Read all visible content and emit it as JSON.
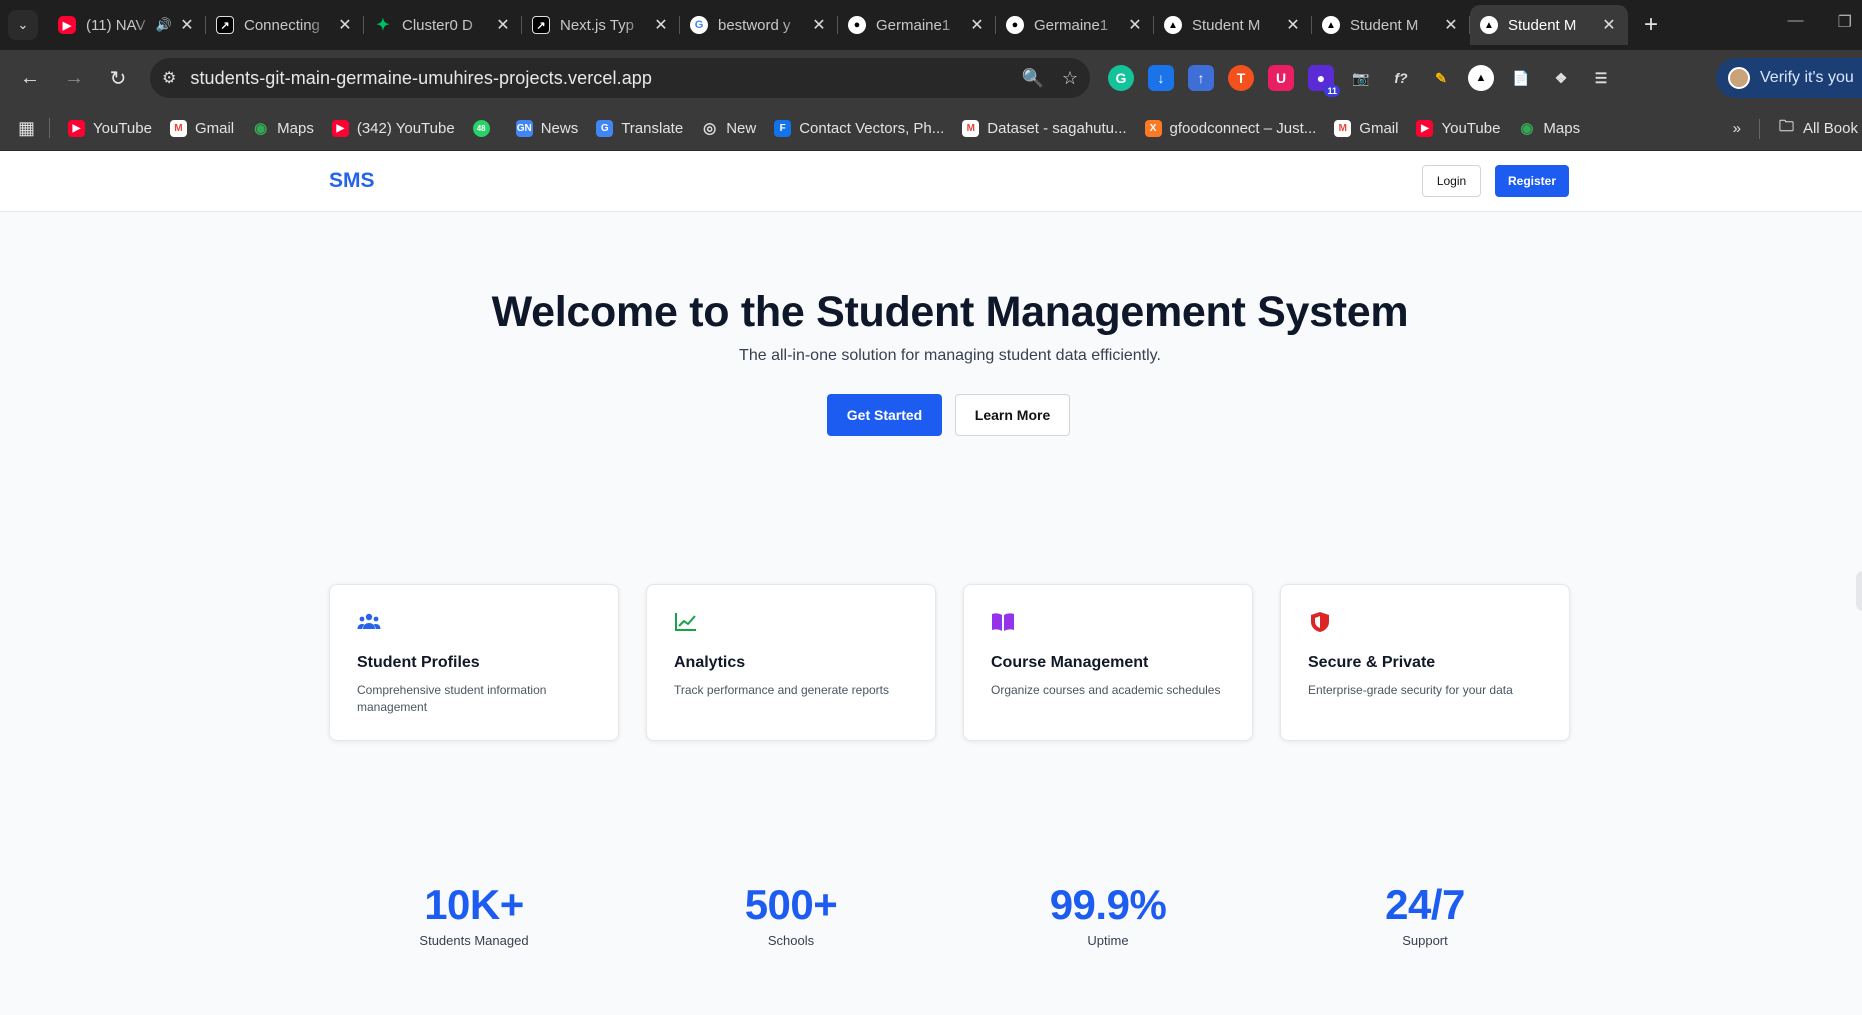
{
  "browser": {
    "tabs": [
      {
        "title": "(11) NAV",
        "favicon": "youtube",
        "audio": true
      },
      {
        "title": "Connecting",
        "favicon": "box"
      },
      {
        "title": "Cluster0 D",
        "favicon": "mongodb-leaf"
      },
      {
        "title": "Next.js Typ",
        "favicon": "box"
      },
      {
        "title": "bestword y",
        "favicon": "google"
      },
      {
        "title": "Germaine1",
        "favicon": "github"
      },
      {
        "title": "Germaine1",
        "favicon": "github"
      },
      {
        "title": "Student M",
        "favicon": "vercel"
      },
      {
        "title": "Student M",
        "favicon": "vercel"
      },
      {
        "title": "Student M",
        "favicon": "vercel",
        "active": true
      }
    ],
    "url": "students-git-main-germaine-umuhires-projects.vercel.app",
    "verify_label": "Verify it's you",
    "extension_badge": "11",
    "bookmarks": [
      {
        "label": "YouTube",
        "icon": "youtube"
      },
      {
        "label": "Gmail",
        "icon": "gmail"
      },
      {
        "label": "Maps",
        "icon": "maps"
      },
      {
        "label": "(342) YouTube",
        "icon": "youtube"
      },
      {
        "label": "",
        "icon": "whatsapp",
        "badge": "48"
      },
      {
        "label": "News",
        "icon": "news"
      },
      {
        "label": "Translate",
        "icon": "translate"
      },
      {
        "label": "New",
        "icon": "globe"
      },
      {
        "label": "Contact Vectors, Ph...",
        "icon": "freepik"
      },
      {
        "label": "Dataset - sagahutu...",
        "icon": "gmail"
      },
      {
        "label": "gfoodconnect – Just...",
        "icon": "xampp"
      },
      {
        "label": "Gmail",
        "icon": "gmail"
      },
      {
        "label": "YouTube",
        "icon": "youtube"
      },
      {
        "label": "Maps",
        "icon": "maps"
      }
    ],
    "all_bookmarks_label": "All Book"
  },
  "site": {
    "logo": "SMS",
    "login_label": "Login",
    "register_label": "Register",
    "hero_title": "Welcome to the Student Management System",
    "hero_subtitle": "The all-in-one solution for managing student data efficiently.",
    "get_started_label": "Get Started",
    "learn_more_label": "Learn More",
    "features": [
      {
        "title": "Student Profiles",
        "desc": "Comprehensive student information management",
        "icon": "users-icon",
        "color": "#2563eb"
      },
      {
        "title": "Analytics",
        "desc": "Track performance and generate reports",
        "icon": "chart-line-icon",
        "color": "#16a34a"
      },
      {
        "title": "Course Management",
        "desc": "Organize courses and academic schedules",
        "icon": "book-open-icon",
        "color": "#9333ea"
      },
      {
        "title": "Secure & Private",
        "desc": "Enterprise-grade security for your data",
        "icon": "shield-icon",
        "color": "#dc2626"
      }
    ],
    "stats": [
      {
        "value": "10K+",
        "label": "Students Managed"
      },
      {
        "value": "500+",
        "label": "Schools"
      },
      {
        "value": "99.9%",
        "label": "Uptime"
      },
      {
        "value": "24/7",
        "label": "Support"
      }
    ]
  },
  "colors": {
    "brand": "#1d5cf0",
    "browser_frame": "#1f1f1f",
    "toolbar": "#3a3a3a"
  }
}
